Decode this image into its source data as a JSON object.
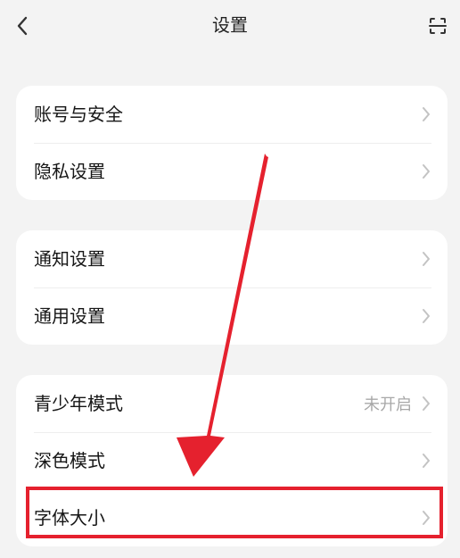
{
  "header": {
    "title": "设置"
  },
  "groups": [
    {
      "items": [
        {
          "label": "账号与安全"
        },
        {
          "label": "隐私设置"
        }
      ]
    },
    {
      "items": [
        {
          "label": "通知设置"
        },
        {
          "label": "通用设置"
        }
      ]
    },
    {
      "items": [
        {
          "label": "青少年模式",
          "value": "未开启"
        },
        {
          "label": "深色模式"
        },
        {
          "label": "字体大小"
        }
      ]
    }
  ],
  "icons": {
    "back": "back-icon",
    "scan": "scan-icon",
    "chevron": "chevron-right-icon"
  },
  "colors": {
    "background": "#f3f3f3",
    "card": "#ffffff",
    "annotation": "#e5212e"
  }
}
